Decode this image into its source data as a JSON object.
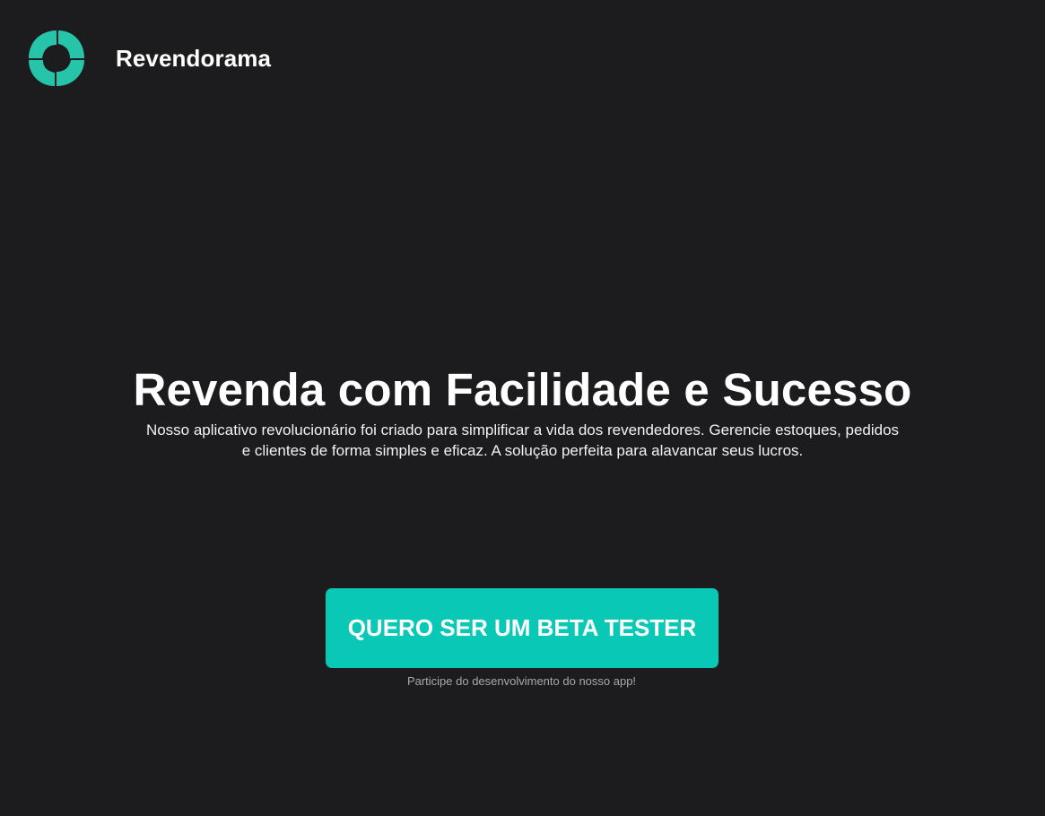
{
  "header": {
    "brand_name": "Revendorama",
    "logo_icon": "swirl-logo-icon",
    "logo_color": "#26c5a9"
  },
  "hero": {
    "title": "Revenda com Facilidade e Sucesso",
    "subtitle": "Nosso aplicativo revolucionário foi criado para simplificar a vida dos revendedores. Gerencie estoques, pedidos e clientes de forma simples e eficaz. A solução perfeita para alavancar seus lucros."
  },
  "cta": {
    "button_label": "QUERO SER UM BETA TESTER",
    "note": "Participe do desenvolvimento do nosso app!",
    "button_color": "#09c8b5"
  },
  "colors": {
    "background": "#1c1c1e",
    "text": "#ffffff",
    "muted_text": "#a8a8ac"
  }
}
